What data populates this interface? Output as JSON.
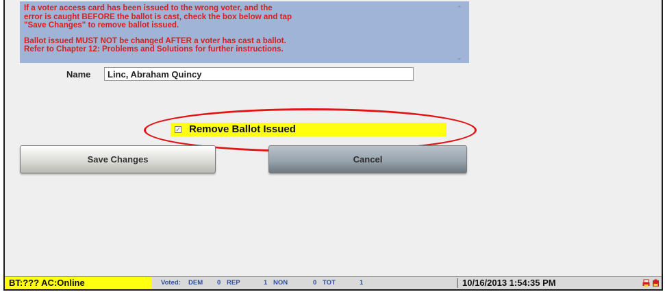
{
  "notice": {
    "line1": "If a voter access card has been issued to the wrong voter,  and the",
    "line2": "error is caught BEFORE the ballot is cast, check the box below and tap",
    "line3": "\"Save Changes\" to remove ballot issued.",
    "line4": "Ballot issued MUST NOT be changed AFTER a voter has cast a ballot.",
    "line5": "Refer to Chapter 12: Problems and Solutions for further instructions."
  },
  "name": {
    "label": "Name",
    "value": "Linc, Abraham Quincy"
  },
  "remove_ballot": {
    "label": "Remove Ballot Issued",
    "checked": true,
    "checkmark": "✓"
  },
  "buttons": {
    "save": "Save Changes",
    "cancel": "Cancel"
  },
  "status_bar": {
    "bt_ac": "BT:??? AC:Online",
    "voted_label": "Voted:",
    "dem_label": "DEM",
    "dem_count": "0",
    "rep_label": "REP",
    "rep_count": "1",
    "non_label": "NON",
    "non_count": "0",
    "tot_label": "TOT",
    "tot_count": "1",
    "datetime": "10/16/2013 1:54:35 PM",
    "icons": [
      "printer-icon",
      "battery-icon"
    ]
  },
  "colors": {
    "notice_bg": "#9fb4d6",
    "notice_text": "#d42020",
    "highlight_yellow": "#ffff10",
    "ellipse_red": "#e11515",
    "counts_blue": "#2f4f9a"
  }
}
